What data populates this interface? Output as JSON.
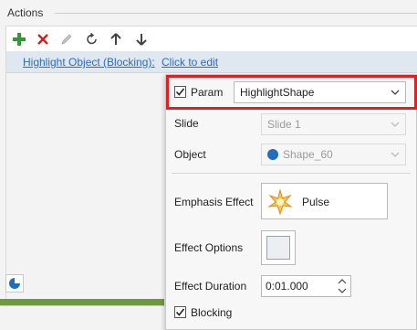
{
  "header": {
    "title": "Actions"
  },
  "toolbar": {
    "add": "add-icon",
    "delete": "delete-icon",
    "edit": "pencil-icon",
    "refresh": "refresh-icon",
    "up": "arrow-up-icon",
    "down": "arrow-down-icon"
  },
  "action": {
    "name": "Highlight Object (Blocking):",
    "edit_link": "Click to edit"
  },
  "props": {
    "param": {
      "label": "Param",
      "checked": true,
      "value": "HighlightShape"
    },
    "slide": {
      "label": "Slide",
      "value": "Slide 1"
    },
    "object": {
      "label": "Object",
      "value": "Shape_60"
    },
    "emphasis": {
      "label": "Emphasis Effect",
      "value": "Pulse"
    },
    "effect_options": {
      "label": "Effect Options"
    },
    "effect_duration": {
      "label": "Effect Duration",
      "value": "0:01.000"
    },
    "blocking": {
      "label": "Blocking",
      "checked": true
    }
  },
  "colors": {
    "highlight": "#e0201e",
    "link": "#2b6cc4",
    "accent_green": "#6c9a3c",
    "shape_dot": "#1f6fbf"
  }
}
